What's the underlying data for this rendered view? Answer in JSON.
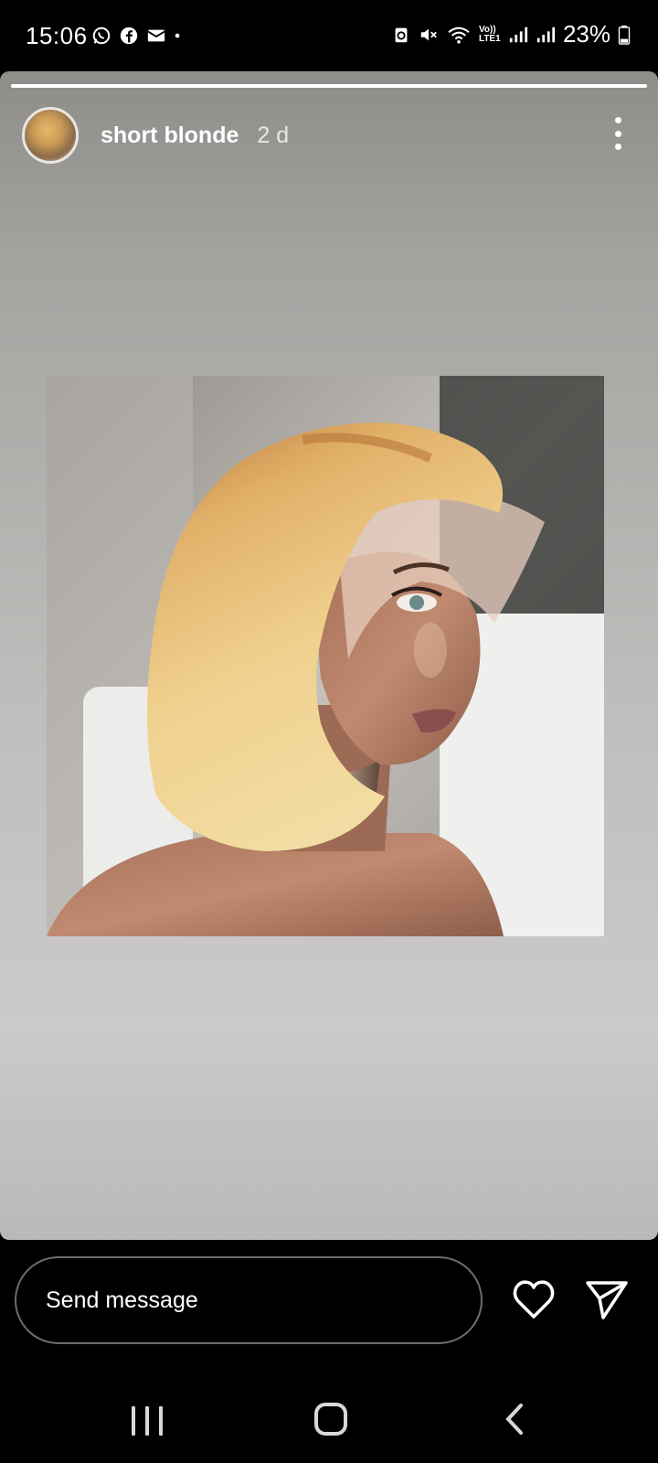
{
  "status_bar": {
    "time": "15:06",
    "left_icons": [
      "whatsapp-icon",
      "facebook-icon",
      "mail-icon",
      "dot-icon"
    ],
    "right_icons": [
      "data-saver-icon",
      "mute-icon",
      "wifi-icon",
      "volte-icon",
      "signal-icon",
      "signal-icon-2",
      "battery-icon"
    ],
    "volte_label": "Vo)) LTE1",
    "battery": "23%"
  },
  "story": {
    "progress": 1.0,
    "username": "short blonde",
    "time_ago": "2 d",
    "image_desc_icon": "photo"
  },
  "bottom": {
    "message_placeholder": "Send message",
    "like_icon": "heart-icon",
    "share_icon": "send-icon"
  },
  "nav": {
    "recents_icon": "recents-icon",
    "home_icon": "home-icon",
    "back_icon": "back-icon"
  }
}
